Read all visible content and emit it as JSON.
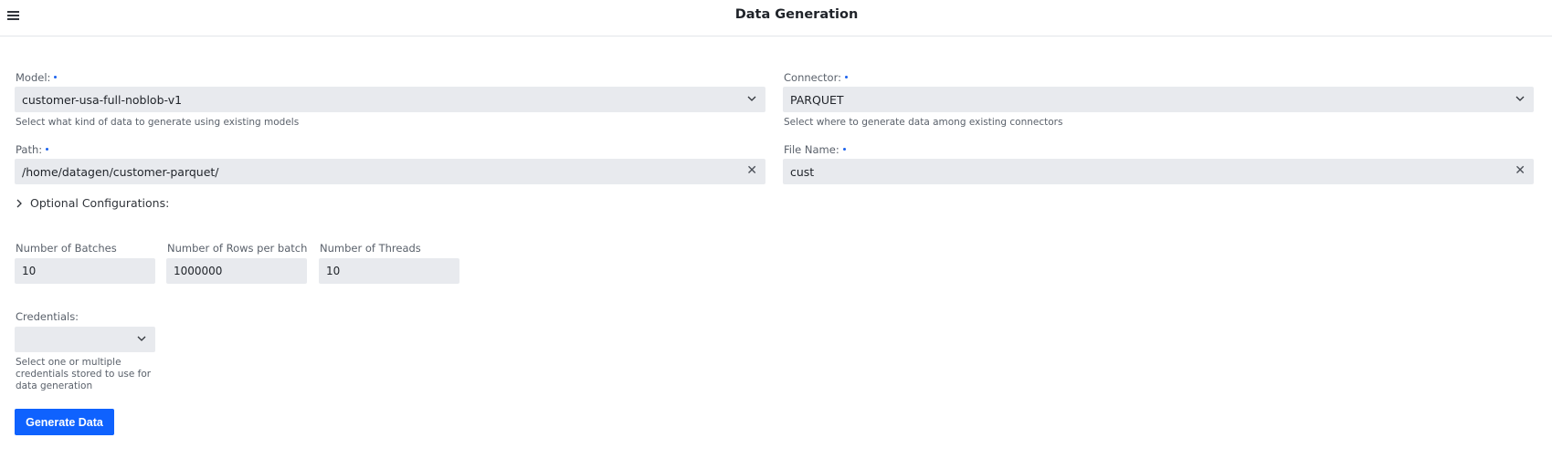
{
  "header": {
    "title": "Data Generation",
    "menu_icon": "hamburger-menu-icon"
  },
  "model": {
    "label": "Model:",
    "value": "customer-usa-full-noblob-v1",
    "helper": "Select what kind of data to generate using existing models"
  },
  "connector": {
    "label": "Connector:",
    "value": "PARQUET",
    "helper": "Select where to generate data among existing connectors"
  },
  "path": {
    "label": "Path:",
    "value": "/home/datagen/customer-parquet/"
  },
  "file_name": {
    "label": "File Name:",
    "value": "cust"
  },
  "optional": {
    "label": "Optional Configurations:"
  },
  "batches": {
    "label": "Number of Batches",
    "value": "10"
  },
  "rows_per_batch": {
    "label": "Number of Rows per batch",
    "value": "1000000"
  },
  "threads": {
    "label": "Number of Threads",
    "value": "10"
  },
  "credentials": {
    "label": "Credentials:",
    "value": "",
    "helper_lines": [
      "Select one or multiple",
      "credentials stored to use for",
      "data generation"
    ]
  },
  "actions": {
    "generate_label": "Generate Data"
  },
  "colors": {
    "primary": "#0f62fe",
    "required_dot": "#1d63ed",
    "field_bg": "#e8eaee"
  }
}
